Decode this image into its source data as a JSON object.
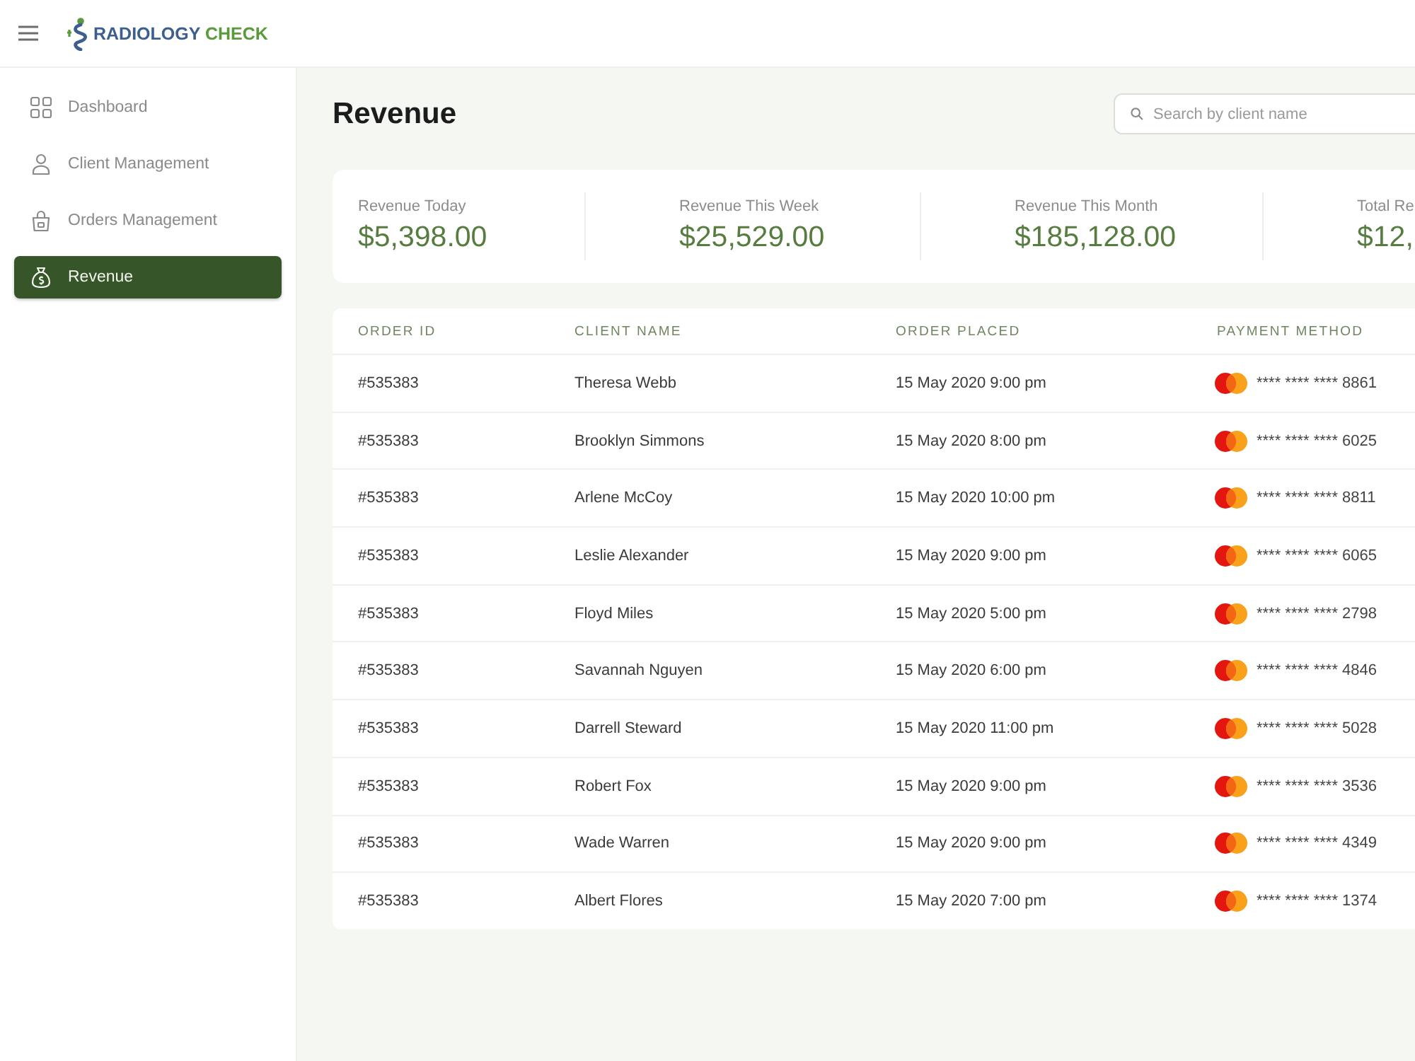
{
  "header": {
    "brand": {
      "name": "RADIOLOGY",
      "accent": "CHECK"
    }
  },
  "sidebar": {
    "items": [
      {
        "label": "Dashboard",
        "selected": false
      },
      {
        "label": "Client Management",
        "selected": false
      },
      {
        "label": "Orders Management",
        "selected": false
      },
      {
        "label": "Revenue",
        "selected": true
      }
    ]
  },
  "page": {
    "title": "Revenue",
    "search": {
      "placeholder": "Search by client name"
    }
  },
  "stats": [
    {
      "label": "Revenue Today",
      "value": "$5,398.00"
    },
    {
      "label": "Revenue This Week",
      "value": "$25,529.00"
    },
    {
      "label": "Revenue This Month",
      "value": "$185,128.00"
    },
    {
      "label": "Total Re",
      "value": "$12,"
    }
  ],
  "table": {
    "columns": [
      "ORDER ID",
      "CLIENT NAME",
      "ORDER PLACED",
      "PAYMENT METHOD"
    ],
    "rows": [
      {
        "order_id": "#535383",
        "client_name": "Theresa Webb",
        "order_placed": "15 May 2020 9:00 pm",
        "payment_method": "**** **** **** 8861"
      },
      {
        "order_id": "#535383",
        "client_name": "Brooklyn Simmons",
        "order_placed": "15 May 2020 8:00 pm",
        "payment_method": "**** **** **** 6025"
      },
      {
        "order_id": "#535383",
        "client_name": "Arlene McCoy",
        "order_placed": "15 May 2020 10:00 pm",
        "payment_method": "**** **** **** 8811"
      },
      {
        "order_id": "#535383",
        "client_name": "Leslie Alexander",
        "order_placed": "15 May 2020 9:00 pm",
        "payment_method": "**** **** **** 6065"
      },
      {
        "order_id": "#535383",
        "client_name": "Floyd Miles",
        "order_placed": "15 May 2020 5:00 pm",
        "payment_method": "**** **** **** 2798"
      },
      {
        "order_id": "#535383",
        "client_name": "Savannah Nguyen",
        "order_placed": "15 May 2020 6:00 pm",
        "payment_method": "**** **** **** 4846"
      },
      {
        "order_id": "#535383",
        "client_name": "Darrell Steward",
        "order_placed": "15 May 2020 11:00 pm",
        "payment_method": "**** **** **** 5028"
      },
      {
        "order_id": "#535383",
        "client_name": "Robert Fox",
        "order_placed": "15 May 2020 9:00 pm",
        "payment_method": "**** **** **** 3536"
      },
      {
        "order_id": "#535383",
        "client_name": "Wade Warren",
        "order_placed": "15 May 2020 9:00 pm",
        "payment_method": "**** **** **** 4349"
      },
      {
        "order_id": "#535383",
        "client_name": "Albert Flores",
        "order_placed": "15 May 2020 7:00 pm",
        "payment_method": "**** **** **** 1374"
      }
    ]
  }
}
